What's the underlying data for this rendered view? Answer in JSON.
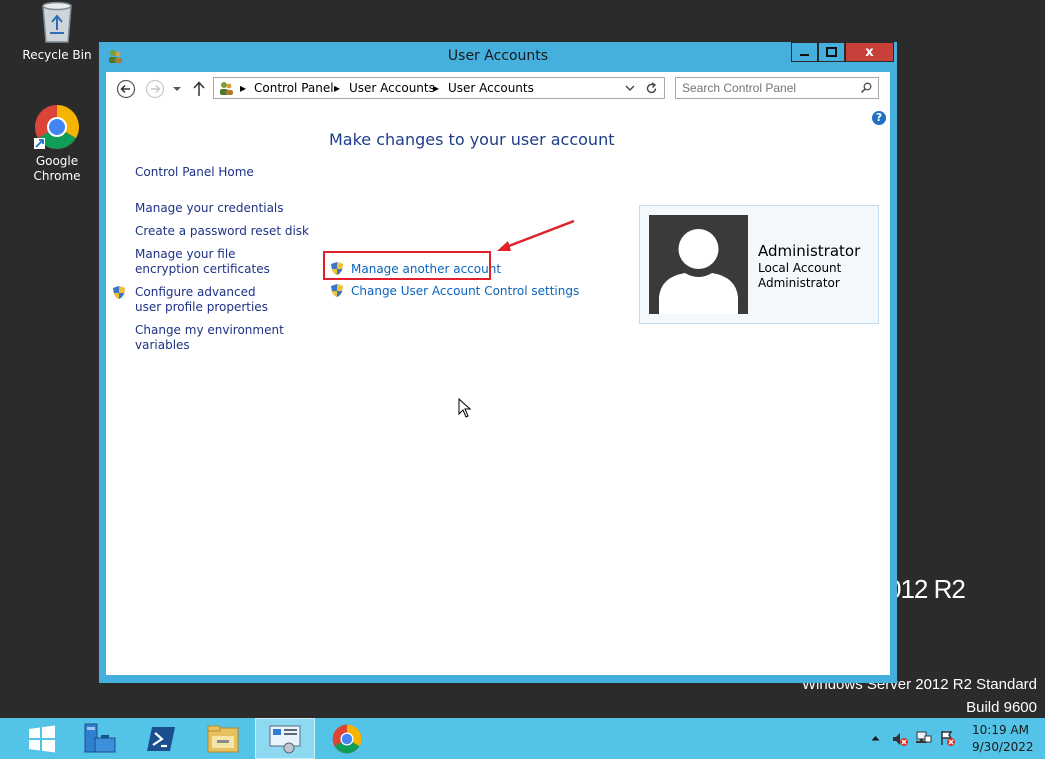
{
  "desktop": {
    "recycle_bin_label": "Recycle Bin",
    "chrome_label_line1": "Google",
    "chrome_label_line2": "Chrome",
    "watermark_r2": "012 R2",
    "watermark_edition": "Windows Server 2012 R2 Standard",
    "watermark_build": "Build 9600"
  },
  "window": {
    "title": "User Accounts",
    "close_label": "x"
  },
  "navbar": {
    "breadcrumbs": [
      "Control Panel",
      "User Accounts",
      "User Accounts"
    ],
    "search_placeholder": "Search Control Panel"
  },
  "sidebar": {
    "home": "Control Panel Home",
    "links": [
      "Manage your credentials",
      "Create a password reset disk",
      "Manage your file encryption certificates",
      "Configure advanced user profile properties",
      "Change my environment variables"
    ]
  },
  "main": {
    "heading": "Make changes to your user account",
    "links": [
      "Manage another account",
      "Change User Account Control settings"
    ]
  },
  "user": {
    "name": "Administrator",
    "type": "Local Account",
    "role": "Administrator"
  },
  "taskbar": {
    "time": "10:19 AM",
    "date": "9/30/2022"
  },
  "colors": {
    "accent": "#45b0de",
    "taskbar": "#54c3e8",
    "link": "#0a64bd",
    "highlight": "#e0202a"
  }
}
